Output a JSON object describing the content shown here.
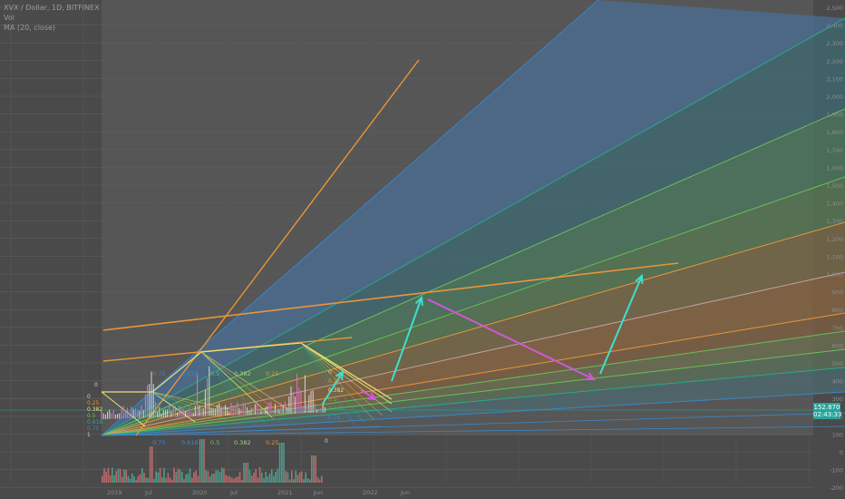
{
  "legend": {
    "symbol_line": "XVX / Dollar, 1D, BITFINEX",
    "volume_label": "Vol",
    "ma_label": "MA (20, close)"
  },
  "price_tag": {
    "price": "152.870",
    "countdown": "02:43:33"
  },
  "colors": {
    "background": "#4a4a4a",
    "plot_area": "#565656",
    "fan_blue": "#3a86c8",
    "fan_teal": "#2aa88a",
    "fan_green": "#6abf5a",
    "fan_orange": "#e8963a",
    "arrow_cyan": "#3ee0d0",
    "arrow_magenta": "#d257d8",
    "trendline_yellow": "#e8e07a",
    "price_tag": "#26a69a"
  },
  "chart_data": {
    "type": "line",
    "x_axis": {
      "type": "date",
      "tick_labels": [
        "2019",
        "Jul",
        "2020",
        "Jul",
        "2021",
        "Jun",
        "2022",
        "Jun"
      ]
    },
    "y_axis": {
      "range": [
        -250,
        2500
      ],
      "tick_labels": [
        "2,500",
        "2,400",
        "2,300",
        "2,200",
        "2,100",
        "2,000",
        "1,900",
        "1,800",
        "1,700",
        "1,600",
        "1,500",
        "1,400",
        "1,300",
        "1,200",
        "1,100",
        "1,000",
        "900",
        "800",
        "700",
        "600",
        "500",
        "400",
        "300",
        "200",
        "100",
        "0",
        "-100",
        "-200"
      ]
    },
    "fib_levels_upper": [
      "0.75",
      "0.618",
      "0.5",
      "0.382",
      "0.25"
    ],
    "fib_levels_lower": [
      "0.75",
      "0.618",
      "0.5",
      "0.382",
      "0.25"
    ],
    "fib_levels_left": [
      "0",
      "0.25",
      "0.382",
      "0.5",
      "0.618",
      "0.75",
      "1"
    ],
    "fib_levels_right": [
      "0",
      "0.25",
      "0.382",
      "0.5",
      "0.618",
      "0.75"
    ],
    "price_marker_top": "0",
    "price_marker_bottom": "0",
    "last_price": 152.87
  }
}
